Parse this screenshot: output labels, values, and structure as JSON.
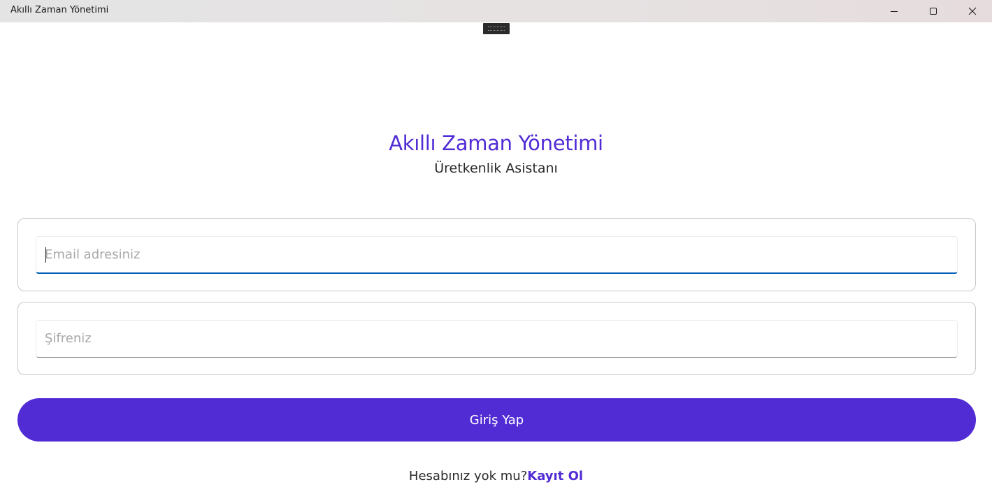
{
  "window": {
    "title": "Akıllı Zaman Yönetimi",
    "controls": {
      "minimize_icon": "minimize-icon",
      "maximize_icon": "maximize-icon",
      "close_icon": "close-icon"
    }
  },
  "header": {
    "app_title": "Akıllı Zaman Yönetimi",
    "subtitle": "Üretkenlik Asistanı"
  },
  "form": {
    "email": {
      "value": "",
      "placeholder": "Email adresiniz",
      "focused": true
    },
    "password": {
      "value": "",
      "placeholder": "Şifreniz"
    },
    "login_button_label": "Giriş Yap"
  },
  "footer": {
    "signup_question": "Hesabınız yok mu?",
    "signup_link_label": "Kayıt Ol"
  },
  "colors": {
    "accent": "#512bd4",
    "focus_underline": "#005fb8",
    "card_border": "#c8c8c8"
  }
}
